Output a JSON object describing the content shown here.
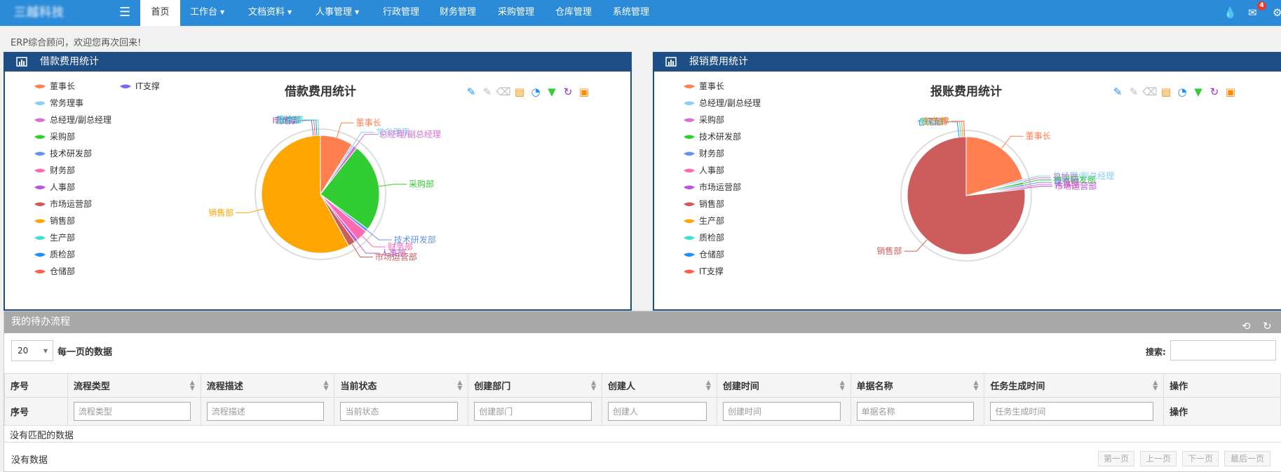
{
  "brand": {
    "logo_text": "三越科技"
  },
  "nav": {
    "items": [
      {
        "label": "首页",
        "active": true,
        "caret": false
      },
      {
        "label": "工作台",
        "caret": true
      },
      {
        "label": "文档资料",
        "caret": true
      },
      {
        "label": "人事管理",
        "caret": true
      },
      {
        "label": "行政管理",
        "caret": false
      },
      {
        "label": "财务管理",
        "caret": false
      },
      {
        "label": "采购管理",
        "caret": false
      },
      {
        "label": "仓库管理",
        "caret": false
      },
      {
        "label": "系统管理",
        "caret": false
      }
    ],
    "notification_count": "4",
    "icons": [
      "menu-icon",
      "water-drop-icon",
      "envelope-icon",
      "gear-icon"
    ]
  },
  "welcome": "ERP综合顾问，欢迎您再次回来!",
  "toolbox_icons": [
    "mark-icon",
    "mark-undo-icon",
    "mark-clear-icon",
    "data-view-icon",
    "pie-switch-icon",
    "funnel-switch-icon",
    "restore-icon",
    "save-image-icon"
  ],
  "chart_data": [
    {
      "type": "pie",
      "panel_title": "借款费用统计",
      "title": "借款费用统计",
      "legend": [
        "董事长",
        "IT支撑",
        "常务理事",
        "总经理/副总经理",
        "采购部",
        "技术研发部",
        "财务部",
        "人事部",
        "市场运营部",
        "销售部",
        "生产部",
        "质检部",
        "仓储部"
      ],
      "slice_labels": [
        "董事长",
        "常务理事",
        "总经理/副总经理",
        "采购部",
        "技术研发部",
        "财务部",
        "人事部",
        "市场运营部",
        "销售部",
        "IT支撑",
        "仓储部",
        "质检部",
        "生产部"
      ],
      "values": [
        9.0,
        0.6,
        1.0,
        24.5,
        0.8,
        3.2,
        0.9,
        2.0,
        58.0,
        0.0,
        0.0,
        0.0,
        0.0
      ],
      "colors": [
        "#ff7f50",
        "#87cefa",
        "#da70d6",
        "#32cd32",
        "#6495ed",
        "#ff69b4",
        "#ba55d3",
        "#cd5c5c",
        "#ffa500",
        "#7b68ee",
        "#ff6347",
        "#1e90ff",
        "#40e0d0"
      ]
    },
    {
      "type": "pie",
      "panel_title": "报销费用统计",
      "title": "报账费用统计",
      "legend": [
        "董事长",
        "总经理/副总经理",
        "采购部",
        "技术研发部",
        "财务部",
        "人事部",
        "市场运营部",
        "销售部",
        "生产部",
        "质检部",
        "仓储部",
        "IT支撑"
      ],
      "slice_labels": [
        "董事长",
        "总经理/副总经理",
        "采购部",
        "技术研发部",
        "财务部",
        "人事部",
        "市场运营部",
        "销售部",
        "仓储部",
        "质检部",
        "生产部",
        "IT支撑"
      ],
      "values": [
        20.5,
        0.5,
        0.3,
        0.6,
        0.5,
        0.4,
        0.4,
        76.8,
        0.0,
        0.0,
        0.0,
        0.0
      ],
      "colors": [
        "#ff7f50",
        "#87cefa",
        "#da70d6",
        "#32cd32",
        "#6495ed",
        "#ff69b4",
        "#ba55d3",
        "#cd5c5c",
        "#1e90ff",
        "#40e0d0",
        "#ffa500",
        "#ff6347"
      ]
    }
  ],
  "todo": {
    "title": "我的待办流程",
    "page_size": "20",
    "page_size_label": "每一页的数据",
    "search_label": "搜索:",
    "columns": [
      "序号",
      "流程类型",
      "流程描述",
      "当前状态",
      "创建部门",
      "创建人",
      "创建时间",
      "单据名称",
      "任务生成时间",
      "操作"
    ],
    "filter_placeholders": [
      "流程类型",
      "流程描述",
      "当前状态",
      "创建部门",
      "创建人",
      "创建时间",
      "单据名称",
      "任务生成时间"
    ],
    "empty_match": "没有匹配的数据",
    "empty_data": "没有数据",
    "pager": [
      "第一页",
      "上一页",
      "下一页",
      "最后一页"
    ]
  }
}
